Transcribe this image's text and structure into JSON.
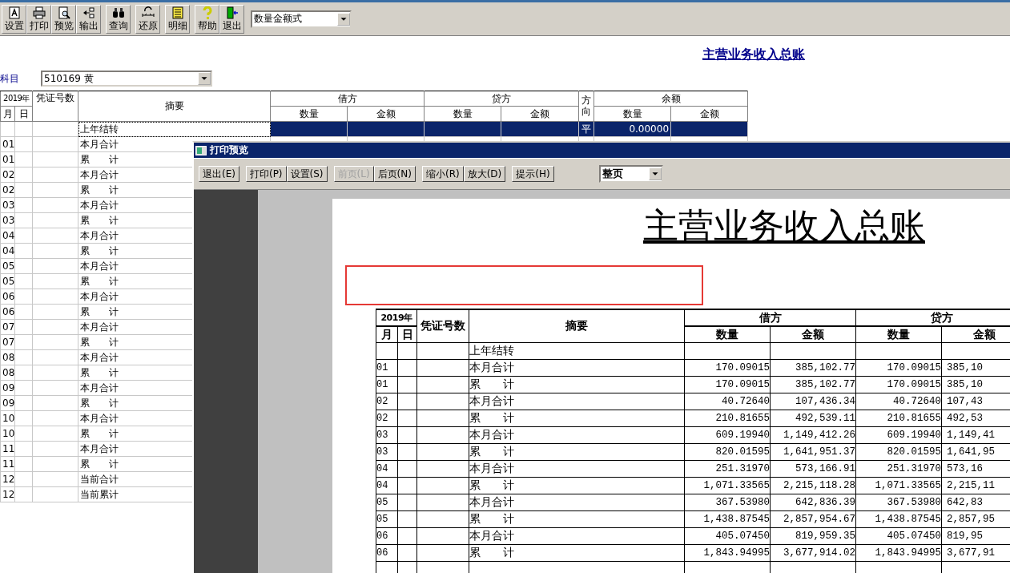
{
  "toolbar": {
    "groups": [
      [
        {
          "label": "设置"
        },
        {
          "label": "打印"
        },
        {
          "label": "预览"
        },
        {
          "label": "输出"
        }
      ],
      [
        {
          "label": "查询"
        }
      ],
      [
        {
          "label": "还原"
        }
      ],
      [
        {
          "label": "明细"
        }
      ],
      [
        {
          "label": "帮助"
        },
        {
          "label": "退出"
        }
      ]
    ],
    "view_select": "数量金额式"
  },
  "report_title": "主营业务收入总账",
  "account": {
    "label": "科目",
    "value": "510169 黄"
  },
  "ledger": {
    "columns": {
      "year": "2019年",
      "month": "月",
      "day": "日",
      "voucher": "凭证号数",
      "summary": "摘要",
      "debit": "借方",
      "credit": "贷方",
      "direction": "方向",
      "balance": "余额",
      "sub": [
        "数量",
        "金额",
        "数量",
        "金额",
        "数量",
        "金额"
      ]
    },
    "rows": [
      {
        "month": "",
        "summary": "上年结转",
        "direction": "平",
        "balance_qty": "0.00000",
        "selected": true
      },
      {
        "month": "01",
        "summary": "本月合计",
        "selected": false
      },
      {
        "month": "01",
        "summary": "累　　计",
        "selected": false
      },
      {
        "month": "02",
        "summary": "本月合计",
        "selected": false
      },
      {
        "month": "02",
        "summary": "累　　计",
        "selected": false
      },
      {
        "month": "03",
        "summary": "本月合计",
        "selected": false
      },
      {
        "month": "03",
        "summary": "累　　计",
        "selected": false
      },
      {
        "month": "04",
        "summary": "本月合计",
        "selected": false
      },
      {
        "month": "04",
        "summary": "累　　计",
        "selected": false
      },
      {
        "month": "05",
        "summary": "本月合计",
        "selected": false
      },
      {
        "month": "05",
        "summary": "累　　计",
        "selected": false
      },
      {
        "month": "06",
        "summary": "本月合计",
        "selected": false
      },
      {
        "month": "06",
        "summary": "累　　计",
        "selected": false
      },
      {
        "month": "07",
        "summary": "本月合计",
        "selected": false
      },
      {
        "month": "07",
        "summary": "累　　计",
        "selected": false
      },
      {
        "month": "08",
        "summary": "本月合计",
        "selected": false
      },
      {
        "month": "08",
        "summary": "累　　计",
        "selected": false
      },
      {
        "month": "09",
        "summary": "本月合计",
        "selected": false
      },
      {
        "month": "09",
        "summary": "累　　计",
        "selected": false
      },
      {
        "month": "10",
        "summary": "本月合计",
        "selected": false
      },
      {
        "month": "10",
        "summary": "累　　计",
        "selected": false
      },
      {
        "month": "11",
        "summary": "本月合计",
        "selected": false
      },
      {
        "month": "11",
        "summary": "累　　计",
        "selected": false
      },
      {
        "month": "12",
        "summary": "当前合计",
        "selected": false
      },
      {
        "month": "12",
        "summary": "当前累计",
        "selected": false
      }
    ]
  },
  "preview": {
    "title": "打印预览",
    "buttons": [
      {
        "label": "退出(E)",
        "disabled": false
      },
      {
        "label": "打印(P)",
        "disabled": false
      },
      {
        "label": "设置(S)",
        "disabled": false
      },
      {
        "label": "前页(L)",
        "disabled": true
      },
      {
        "label": "后页(N)",
        "disabled": false
      },
      {
        "label": "缩小(R)",
        "disabled": false
      },
      {
        "label": "放大(D)",
        "disabled": false
      },
      {
        "label": "提示(H)",
        "disabled": false
      }
    ],
    "zoom_select": "整页",
    "page": {
      "title": "主营业务收入总账",
      "columns": {
        "year": "2019年",
        "month": "月",
        "day": "日",
        "voucher": "凭证号数",
        "summary": "摘要",
        "debit": "借方",
        "credit": "贷方",
        "sub": [
          "数量",
          "金额",
          "数量",
          "金额"
        ]
      },
      "rows": [
        {
          "month": "",
          "summary": "上年结转",
          "debit_qty": "",
          "debit_amt": "",
          "credit_qty": "",
          "credit_amt": ""
        },
        {
          "month": "01",
          "summary": "本月合计",
          "debit_qty": "170.09015",
          "debit_amt": "385,102.77",
          "credit_qty": "170.09015",
          "credit_amt": "385,10"
        },
        {
          "month": "01",
          "summary": "累　　计",
          "debit_qty": "170.09015",
          "debit_amt": "385,102.77",
          "credit_qty": "170.09015",
          "credit_amt": "385,10"
        },
        {
          "month": "02",
          "summary": "本月合计",
          "debit_qty": "40.72640",
          "debit_amt": "107,436.34",
          "credit_qty": "40.72640",
          "credit_amt": "107,43"
        },
        {
          "month": "02",
          "summary": "累　　计",
          "debit_qty": "210.81655",
          "debit_amt": "492,539.11",
          "credit_qty": "210.81655",
          "credit_amt": "492,53"
        },
        {
          "month": "03",
          "summary": "本月合计",
          "debit_qty": "609.19940",
          "debit_amt": "1,149,412.26",
          "credit_qty": "609.19940",
          "credit_amt": "1,149,41"
        },
        {
          "month": "03",
          "summary": "累　　计",
          "debit_qty": "820.01595",
          "debit_amt": "1,641,951.37",
          "credit_qty": "820.01595",
          "credit_amt": "1,641,95"
        },
        {
          "month": "04",
          "summary": "本月合计",
          "debit_qty": "251.31970",
          "debit_amt": "573,166.91",
          "credit_qty": "251.31970",
          "credit_amt": "573,16"
        },
        {
          "month": "04",
          "summary": "累　　计",
          "debit_qty": "1,071.33565",
          "debit_amt": "2,215,118.28",
          "credit_qty": "1,071.33565",
          "credit_amt": "2,215,11"
        },
        {
          "month": "05",
          "summary": "本月合计",
          "debit_qty": "367.53980",
          "debit_amt": "642,836.39",
          "credit_qty": "367.53980",
          "credit_amt": "642,83"
        },
        {
          "month": "05",
          "summary": "累　　计",
          "debit_qty": "1,438.87545",
          "debit_amt": "2,857,954.67",
          "credit_qty": "1,438.87545",
          "credit_amt": "2,857,95"
        },
        {
          "month": "06",
          "summary": "本月合计",
          "debit_qty": "405.07450",
          "debit_amt": "819,959.35",
          "credit_qty": "405.07450",
          "credit_amt": "819,95"
        },
        {
          "month": "06",
          "summary": "累　　计",
          "debit_qty": "1,843.94995",
          "debit_amt": "3,677,914.02",
          "credit_qty": "1,843.94995",
          "credit_amt": "3,677,91"
        }
      ]
    }
  }
}
